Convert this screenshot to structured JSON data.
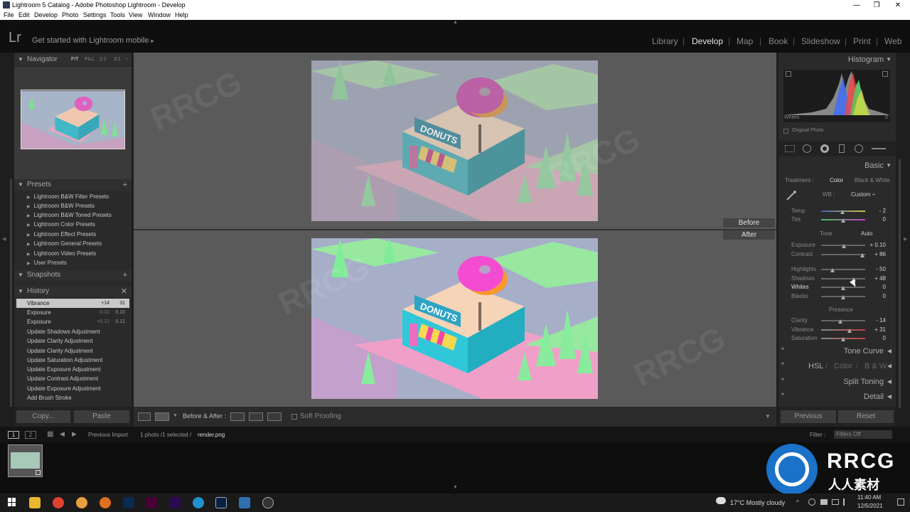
{
  "window": {
    "title": "Lightroom 5 Catalog - Adobe Photoshop Lightroom - Develop",
    "minimize": "—",
    "restore": "❐",
    "close": "✕"
  },
  "menu": [
    "File",
    "Edit",
    "Develop",
    "Photo",
    "Settings",
    "Tools",
    "View",
    "Window",
    "Help"
  ],
  "modulebar": {
    "logo": "Lr",
    "mobile_text": "Get started with Lightroom mobile",
    "mobile_arrow": "▸",
    "modules": [
      "Library",
      "Develop",
      "Map",
      "Book",
      "Slideshow",
      "Print",
      "Web"
    ],
    "active": "Develop"
  },
  "navigator": {
    "title": "Navigator",
    "fit": "FIT",
    "fill": "FILL",
    "one": "1:1",
    "ratio": "3:1"
  },
  "presets": {
    "title": "Presets",
    "add": "+",
    "items": [
      "Lightroom B&W Filter Presets",
      "Lightroom B&W Presets",
      "Lightroom B&W Toned Presets",
      "Lightroom Color Presets",
      "Lightroom Effect Presets",
      "Lightroom General Presets",
      "Lightroom Video Presets",
      "User Presets"
    ]
  },
  "snapshots": {
    "title": "Snapshots",
    "add": "+"
  },
  "history": {
    "title": "History",
    "clear": "✕",
    "items": [
      {
        "label": "Vibrance",
        "v1": "+14",
        "v2": "31"
      },
      {
        "label": "Exposure",
        "v1": "-0.02",
        "v2": "0.10"
      },
      {
        "label": "Exposure",
        "v1": "+0.12",
        "v2": "0.12"
      },
      {
        "label": "Update Shadows Adjustment",
        "v1": "",
        "v2": ""
      },
      {
        "label": "Update Clarity Adjustment",
        "v1": "",
        "v2": ""
      },
      {
        "label": "Update Clarity Adjustment",
        "v1": "",
        "v2": ""
      },
      {
        "label": "Update Saturation Adjustment",
        "v1": "",
        "v2": ""
      },
      {
        "label": "Update Exposure Adjustment",
        "v1": "",
        "v2": ""
      },
      {
        "label": "Update Contrast Adjustment",
        "v1": "",
        "v2": ""
      },
      {
        "label": "Update Exposure Adjustment",
        "v1": "",
        "v2": ""
      },
      {
        "label": "Add Brush Stroke",
        "v1": "",
        "v2": ""
      }
    ]
  },
  "left_buttons": {
    "copy": "Copy...",
    "paste": "Paste"
  },
  "view": {
    "before": "Before",
    "after": "After",
    "sign_text": "DONUTS"
  },
  "toolbar": {
    "before_after": "Before & After :",
    "soft_proofing": "Soft Proofing"
  },
  "histogram": {
    "title": "Histogram",
    "whites": "Whites",
    "whites_val": "0",
    "original_photo": "Original Photo"
  },
  "basic": {
    "title": "Basic",
    "treatment": "Treatment :",
    "color": "Color",
    "bw": "Black & White",
    "wb": "WB :",
    "wb_value": "Custom ÷",
    "tone": "Tone",
    "auto": "Auto",
    "presence": "Presence",
    "sliders": [
      {
        "name": "Temp",
        "value": "- 2",
        "pos": 0.48
      },
      {
        "name": "Tint",
        "value": "0",
        "pos": 0.5
      },
      {
        "name": "Exposure",
        "value": "+ 0.10",
        "pos": 0.51
      },
      {
        "name": "Contrast",
        "value": "+ 86",
        "pos": 0.93
      },
      {
        "name": "Highlights",
        "value": "- 50",
        "pos": 0.25
      },
      {
        "name": "Shadows",
        "value": "+ 48",
        "pos": 0.74
      },
      {
        "name": "Whites",
        "value": "0",
        "pos": 0.5
      },
      {
        "name": "Blacks",
        "value": "0",
        "pos": 0.5
      },
      {
        "name": "Clarity",
        "value": "- 14",
        "pos": 0.43
      },
      {
        "name": "Vibrance",
        "value": "+ 31",
        "pos": 0.65
      },
      {
        "name": "Saturation",
        "value": "0",
        "pos": 0.5
      }
    ]
  },
  "panels": {
    "tone_curve": "Tone Curve",
    "hsl": "HSL",
    "color": "Color",
    "bw": "B & W",
    "split_toning": "Split Toning",
    "detail": "Detail"
  },
  "right_buttons": {
    "previous": "Previous",
    "reset": "Reset"
  },
  "filmbar": {
    "one": "1",
    "two": "2",
    "source": "Previous Import",
    "count": "1 photo /1 selected /",
    "file": "render.png",
    "filter": "Filter :",
    "filter_value": "Filters Off"
  },
  "taskbar": {
    "weather": "17°C  Mostly cloudy",
    "time": "11:40 AM",
    "date": "12/5/2021"
  },
  "watermarks": {
    "text": "RRCG",
    "brand": "RRCG",
    "brand_sub": "人人素材"
  }
}
